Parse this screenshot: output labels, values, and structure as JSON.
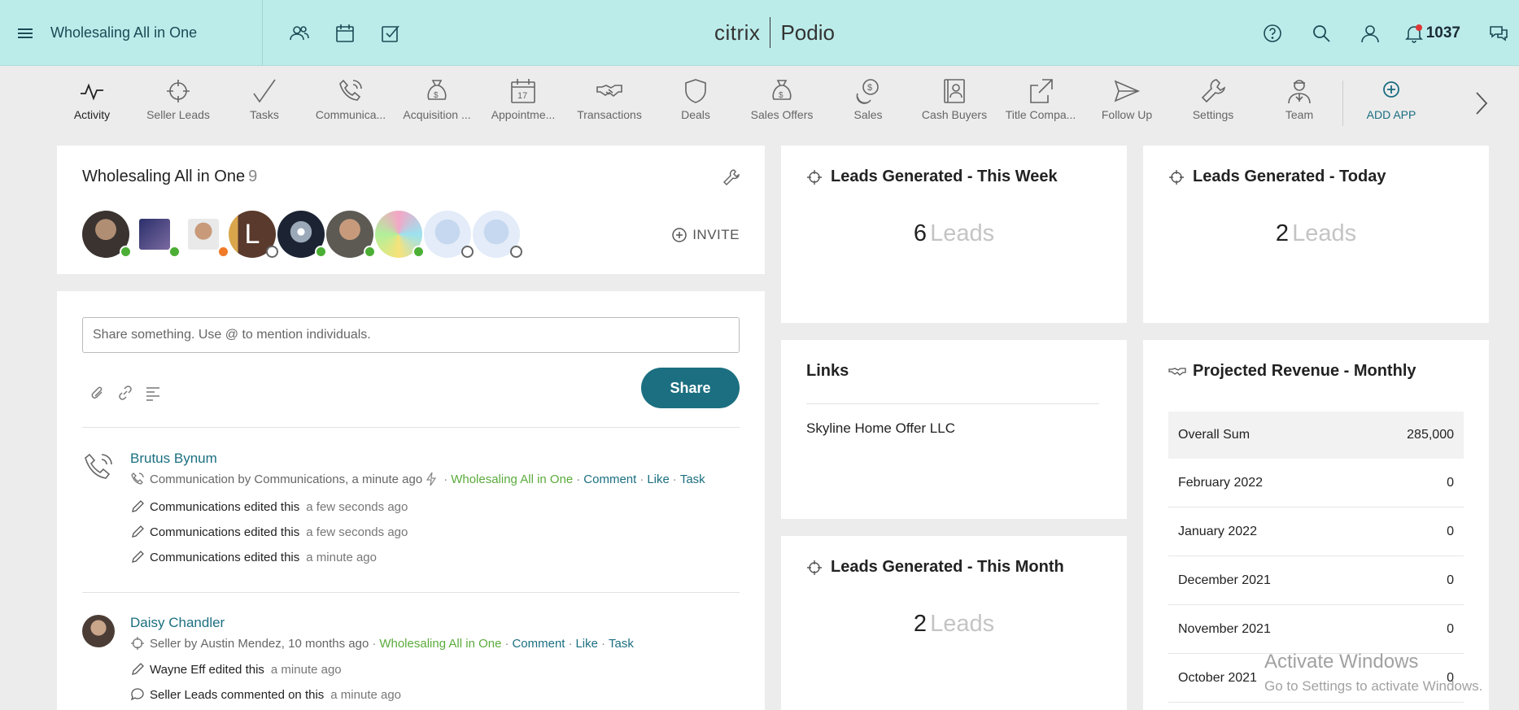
{
  "topbar": {
    "workspace_title": "Wholesaling All in One",
    "brand_left": "citrix",
    "brand_right": "Podio",
    "notification_count": "1037"
  },
  "apps": [
    {
      "label": "Activity",
      "icon": "activity-icon"
    },
    {
      "label": "Seller Leads",
      "icon": "crosshair-icon"
    },
    {
      "label": "Tasks",
      "icon": "check-icon"
    },
    {
      "label": "Communica...",
      "icon": "phone-icon"
    },
    {
      "label": "Acquisition ...",
      "icon": "money-bag-icon"
    },
    {
      "label": "Appointme...",
      "icon": "calendar-icon"
    },
    {
      "label": "Transactions",
      "icon": "handshake-icon"
    },
    {
      "label": "Deals",
      "icon": "shield-icon"
    },
    {
      "label": "Sales Offers",
      "icon": "money-bag-icon"
    },
    {
      "label": "Sales",
      "icon": "coins-icon"
    },
    {
      "label": "Cash Buyers",
      "icon": "contacts-book-icon"
    },
    {
      "label": "Title Compa...",
      "icon": "share-icon"
    },
    {
      "label": "Follow Up",
      "icon": "paper-plane-icon"
    },
    {
      "label": "Settings",
      "icon": "wrench-icon"
    },
    {
      "label": "Team",
      "icon": "person-icon"
    },
    {
      "label": "ADD APP",
      "icon": "plus-circle-icon"
    }
  ],
  "workspace": {
    "title": "Wholesaling All in One",
    "member_count": "9",
    "invite_label": "INVITE"
  },
  "feed": {
    "share_placeholder": "Share something. Use @ to mention individuals.",
    "share_button": "Share",
    "items": [
      {
        "name": "Brutus Bynum",
        "app": "Communication",
        "by_word": "by",
        "author": "Communications, a minute ago",
        "workspace": "Wholesaling All in One",
        "actions": [
          "Comment",
          "Like",
          "Task"
        ],
        "activities": [
          {
            "text": "Communications edited this",
            "when": "a few seconds ago"
          },
          {
            "text": "Communications edited this",
            "when": "a few seconds ago"
          },
          {
            "text": "Communications edited this",
            "when": "a minute ago"
          }
        ]
      },
      {
        "name": "Daisy Chandler",
        "app": "Seller",
        "by_word": "by",
        "author": "Austin Mendez, 10 months ago",
        "workspace": "Wholesaling All in One",
        "actions": [
          "Comment",
          "Like",
          "Task"
        ],
        "activities": [
          {
            "text": "Wayne Eff edited this",
            "when": "a minute ago"
          },
          {
            "text": "Seller Leads commented on this",
            "when": "a minute ago"
          }
        ]
      }
    ]
  },
  "widgets": {
    "week": {
      "title": "Leads Generated - This Week",
      "value": "6",
      "unit": "Leads"
    },
    "today": {
      "title": "Leads Generated - Today",
      "value": "2",
      "unit": "Leads"
    },
    "month": {
      "title": "Leads Generated - This Month",
      "value": "2",
      "unit": "Leads"
    },
    "links": {
      "title": "Links",
      "items": [
        "Skyline Home Offer LLC"
      ]
    },
    "revenue": {
      "title": "Projected Revenue - Monthly",
      "rows": [
        {
          "label": "Overall Sum",
          "value": "285,000"
        },
        {
          "label": "February 2022",
          "value": "0"
        },
        {
          "label": "January 2022",
          "value": "0"
        },
        {
          "label": "December 2021",
          "value": "0"
        },
        {
          "label": "November 2021",
          "value": "0"
        },
        {
          "label": "October 2021",
          "value": "0"
        }
      ]
    }
  },
  "watermark": {
    "line1": "Activate Windows",
    "line2": "Go to Settings to activate Windows."
  },
  "colors": {
    "topbar": "#bcecea",
    "accent": "#1b6f80",
    "workspace_link": "#5bab3c",
    "online": "#4caf35",
    "away": "#f07a28"
  }
}
